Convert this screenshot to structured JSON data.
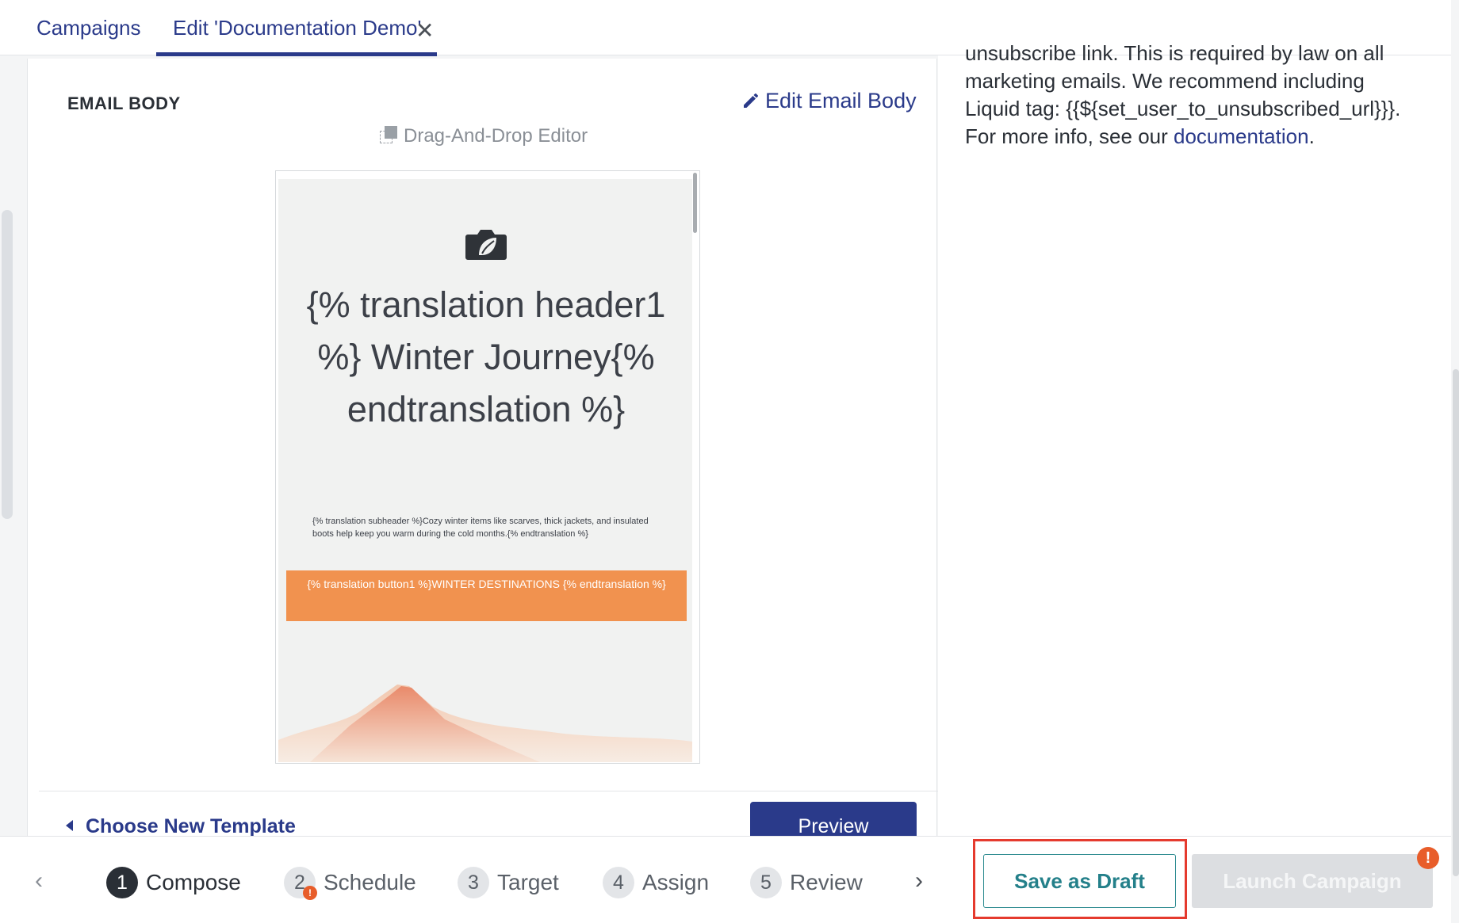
{
  "tabs": {
    "campaigns": "Campaigns",
    "edit": "Edit 'Documentation Demo'",
    "close": "✕"
  },
  "email_body": {
    "title": "EMAIL BODY",
    "edit_label": "Edit Email Body",
    "editor_label": "Drag-And-Drop Editor",
    "header_text": "{% translation header1 %} Winter Journey{% endtranslation %}",
    "subheader_text": "{% translation subheader %}Cozy winter items like scarves, thick jackets, and insulated boots help keep you warm during the cold months.{% endtranslation %}",
    "button_text": "{% translation button1 %}WINTER DESTINATIONS {% endtranslation %}",
    "choose_template": "Choose New Template",
    "preview": "Preview"
  },
  "right_panel": {
    "text_before": "unsubscribe link. This is required by law on all marketing emails. We recommend including Liquid tag: {{${set_user_to_unsubscribed_url}}}. For more info, see our ",
    "link": "documentation",
    "text_after": "."
  },
  "steps": [
    {
      "number": "1",
      "label": "Compose",
      "active": true
    },
    {
      "number": "2",
      "label": "Schedule",
      "warning": true
    },
    {
      "number": "3",
      "label": "Target"
    },
    {
      "number": "4",
      "label": "Assign"
    },
    {
      "number": "5",
      "label": "Review"
    }
  ],
  "nav": {
    "prev": "‹",
    "next": "›"
  },
  "actions": {
    "save_draft": "Save as Draft",
    "launch": "Launch Campaign",
    "warning_glyph": "!"
  },
  "colors": {
    "brand": "#2a3a8a",
    "email_button": "#f1924f",
    "draft_border": "#2b8a8f",
    "highlight": "#e53a2e",
    "warning": "#e85d2a"
  }
}
